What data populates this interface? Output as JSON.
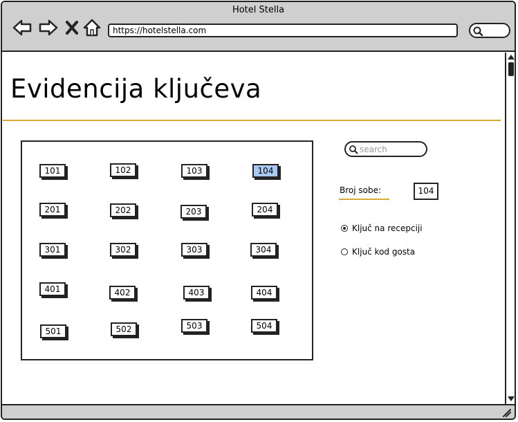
{
  "window": {
    "title": "Hotel Stella"
  },
  "browser": {
    "url": "https://hotelstella.com"
  },
  "page": {
    "title": "Evidencija ključeva"
  },
  "rooms": [
    "101",
    "102",
    "103",
    "104",
    "201",
    "202",
    "203",
    "204",
    "301",
    "302",
    "303",
    "304",
    "401",
    "402",
    "403",
    "404",
    "501",
    "502",
    "503",
    "504"
  ],
  "selected_room": "104",
  "search": {
    "placeholder": "search"
  },
  "detail": {
    "room_label": "Broj sobe:",
    "room_value": "104",
    "options": [
      {
        "label": "Ključ na recepciji",
        "checked": true
      },
      {
        "label": "Ključ kod gosta",
        "checked": false
      }
    ]
  },
  "colors": {
    "accent_line": "#d7a937",
    "selected_room": "#a9c9f0",
    "chrome": "#cfcfcf"
  }
}
